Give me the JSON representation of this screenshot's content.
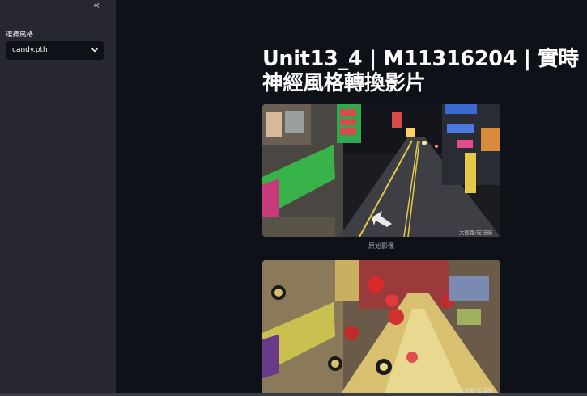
{
  "sidebar": {
    "collapse_glyph": "«",
    "label": "選擇風格",
    "select": {
      "value": "candy.pth",
      "icon": "chevron-down-icon"
    }
  },
  "main": {
    "title": "Unit13_4 | M11316204 | 實時神經風格轉換影片",
    "original_caption": "原始影像",
    "watermark": "大信路/宏法街"
  },
  "colors": {
    "background": "#0e1117",
    "sidebar": "#262730",
    "text": "#fafafa"
  }
}
